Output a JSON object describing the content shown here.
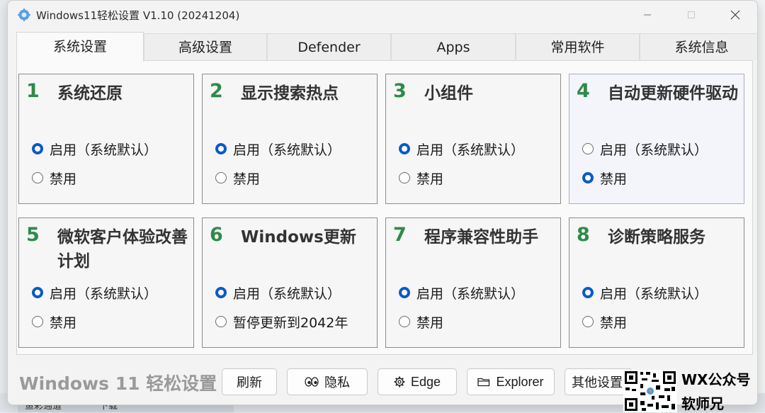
{
  "window": {
    "title": "Windows11轻松设置 V1.10  (20241204)"
  },
  "tabs": [
    {
      "label": "系统设置"
    },
    {
      "label": "高级设置"
    },
    {
      "label": "Defender"
    },
    {
      "label": "Apps"
    },
    {
      "label": "常用软件"
    },
    {
      "label": "系统信息"
    }
  ],
  "cards": [
    {
      "num": "1",
      "title": "系统还原",
      "opt1": "启用（系统默认）",
      "opt2": "禁用",
      "selected": 1
    },
    {
      "num": "2",
      "title": "显示搜索热点",
      "opt1": "启用（系统默认）",
      "opt2": "禁用",
      "selected": 1
    },
    {
      "num": "3",
      "title": "小组件",
      "opt1": "启用（系统默认）",
      "opt2": "禁用",
      "selected": 1
    },
    {
      "num": "4",
      "title": "自动更新硬件驱动",
      "opt1": "启用（系统默认）",
      "opt2": "禁用",
      "selected": 2
    },
    {
      "num": "5",
      "title": "微软客户体验改善计划",
      "opt1": "启用（系统默认）",
      "opt2": "禁用",
      "selected": 1
    },
    {
      "num": "6",
      "title": "Windows更新",
      "opt1": "启用（系统默认）",
      "opt2": "暂停更新到2042年",
      "selected": 1
    },
    {
      "num": "7",
      "title": "程序兼容性助手",
      "opt1": "启用（系统默认）",
      "opt2": "禁用",
      "selected": 1
    },
    {
      "num": "8",
      "title": "诊断策略服务",
      "opt1": "启用（系统默认）",
      "opt2": "禁用",
      "selected": 1
    }
  ],
  "footer": {
    "brand": "Windows 11 轻松设置",
    "refresh": "刷新",
    "privacy": "隐私",
    "edge": "Edge",
    "explorer": "Explorer",
    "other": "其他设置"
  },
  "watermark": {
    "line1": "WX公众号",
    "line2": "软师兄"
  },
  "background": {
    "tab1": "鱼彩通道",
    "tab2": "下载"
  },
  "colors": {
    "accent": "#0a5ac8",
    "number": "#2f8a4a"
  }
}
